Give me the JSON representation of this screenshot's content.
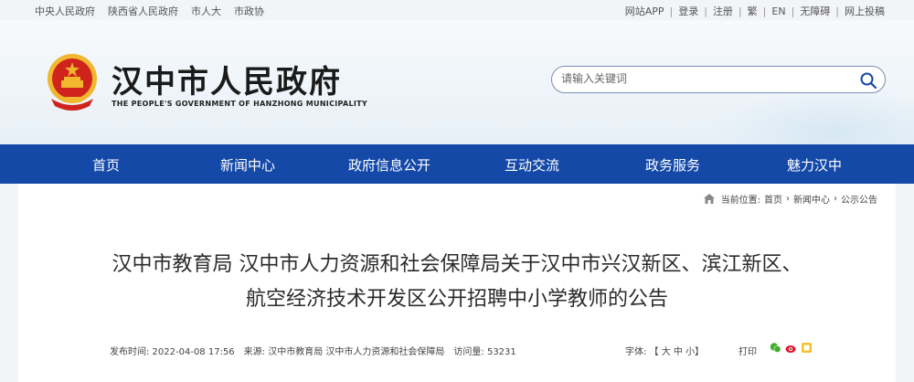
{
  "topbar": {
    "left_links": [
      "中央人民政府",
      "陕西省人民政府",
      "市人大",
      "市政协"
    ],
    "right_links": [
      "网站APP",
      "登录",
      "注册",
      "繁",
      "EN",
      "无障碍",
      "网上投稿"
    ]
  },
  "header": {
    "title": "汉中市人民政府",
    "subtitle": "THE PEOPLE'S GOVERNMENT OF HANZHONG MUNICIPALITY",
    "search_placeholder": "请输入关键词"
  },
  "nav": {
    "items": [
      "首页",
      "新闻中心",
      "政府信息公开",
      "互动交流",
      "政务服务",
      "魅力汉中"
    ]
  },
  "breadcrumb": {
    "prefix": "当前位置:",
    "items": [
      "首页",
      "新闻中心",
      "公示公告"
    ],
    "sep": "›"
  },
  "article": {
    "title_line1": "汉中市教育局 汉中市人力资源和社会保障局关于汉中市兴汉新区、滨江新区、",
    "title_line2": "航空经济技术开发区公开招聘中小学教师的公告",
    "publish_time": "发布时间:  2022-04-08 17:56",
    "source": "来源:  汉中市教育局 汉中市人力资源和社会保障局",
    "views": "访问量:  53231",
    "font_label": "字体:  【 大  中  小】",
    "print_label": "打印"
  },
  "colors": {
    "nav_bg": "#1449a8",
    "search_border": "#7a8fb3",
    "emblem_red": "#d0231b",
    "emblem_gold": "#f0b72f"
  }
}
